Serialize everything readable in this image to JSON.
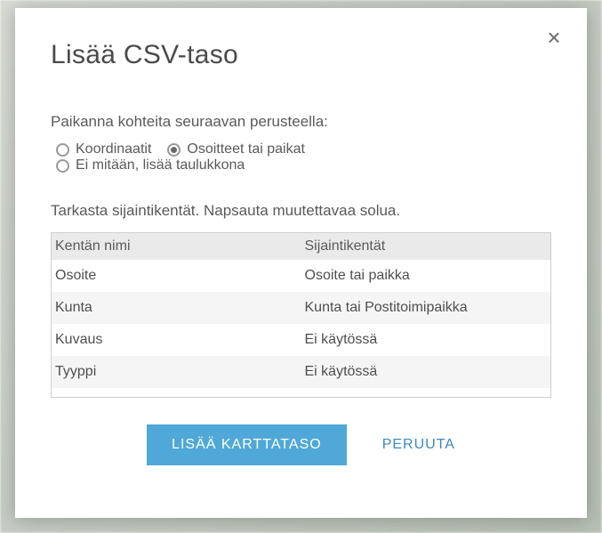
{
  "modal": {
    "title": "Lisää CSV-taso",
    "close_glyph": "×",
    "locate_label": "Paikanna kohteita seuraavan perusteella:",
    "radios": {
      "coordinates": "Koordinaatit",
      "addresses": "Osoitteet tai paikat",
      "none": "Ei mitään, lisää taulukkona"
    },
    "instruction": "Tarkasta sijaintikentät. Napsauta muutettavaa solua.",
    "table": {
      "headers": {
        "field_name": "Kentän nimi",
        "location_fields": "Sijaintikentät"
      },
      "rows": [
        {
          "field": "Osoite",
          "location": "Osoite tai paikka"
        },
        {
          "field": "Kunta",
          "location": "Kunta tai Postitoimipaikka"
        },
        {
          "field": "Kuvaus",
          "location": "Ei käytössä"
        },
        {
          "field": "Tyyppi",
          "location": "Ei käytössä"
        }
      ]
    },
    "buttons": {
      "add_layer": "LISÄÄ KARTTATASO",
      "cancel": "PERUUTA"
    }
  }
}
